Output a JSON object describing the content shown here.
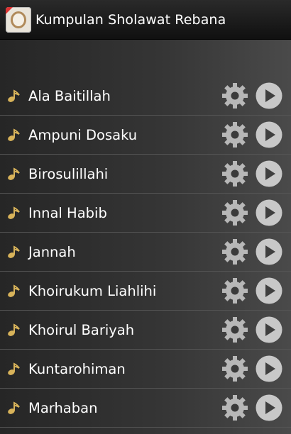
{
  "app": {
    "title": "Kumpulan Sholawat Rebana",
    "icon": "tambourine-app-icon"
  },
  "items": [
    {
      "label": "Ala Baitillah"
    },
    {
      "label": "Ampuni Dosaku"
    },
    {
      "label": "Birosulillahi"
    },
    {
      "label": "Innal Habib"
    },
    {
      "label": "Jannah"
    },
    {
      "label": "Khoirukum Liahlihi"
    },
    {
      "label": "Khoirul Bariyah"
    },
    {
      "label": "Kuntarohiman"
    },
    {
      "label": "Marhaban"
    }
  ],
  "icons": {
    "row_leading": "music-note-icon",
    "settings": "gear-icon",
    "play": "play-icon"
  },
  "colors": {
    "titlebar": "#101010",
    "text": "#ffffff",
    "note": "#d8b35a",
    "control": "#bdbdbd"
  }
}
